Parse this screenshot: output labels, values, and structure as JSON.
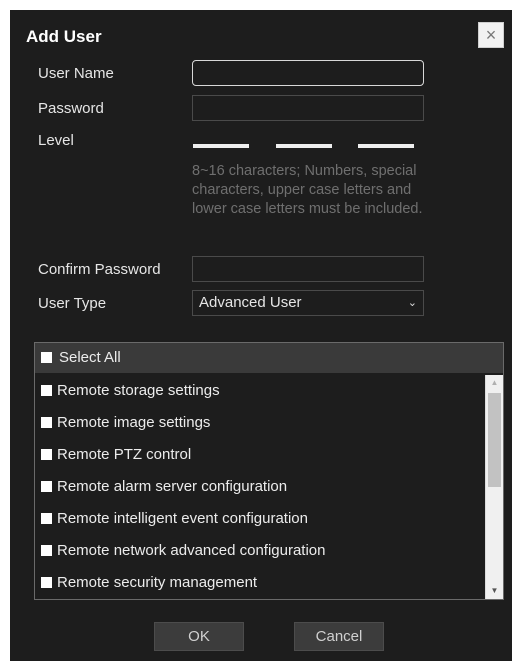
{
  "dialog": {
    "title": "Add User",
    "close_symbol": "×"
  },
  "form": {
    "username_label": "User Name",
    "username_value": "",
    "password_label": "Password",
    "password_value": "",
    "level_label": "Level",
    "password_hint": "8~16 characters; Numbers, special characters, upper case letters and lower case letters must be included.",
    "confirm_label": "Confirm Password",
    "confirm_value": "",
    "user_type_label": "User Type",
    "user_type_value": "Advanced User"
  },
  "permissions": {
    "select_all_label": "Select All",
    "items": [
      "Remote storage settings",
      "Remote image settings",
      "Remote PTZ control",
      "Remote alarm server configuration",
      "Remote intelligent event configuration",
      "Remote network advanced configuration",
      "Remote security management"
    ]
  },
  "buttons": {
    "ok": "OK",
    "cancel": "Cancel"
  },
  "colors": {
    "dialog_bg": "#1d1d1d",
    "header_bg": "#3a3a3a",
    "button_bg": "#3c3c3c",
    "hint_text": "#6f6f6f"
  },
  "icons": {
    "close": "close-icon",
    "dropdown": "chevron-down-icon",
    "scroll_up": "arrow-up-icon",
    "scroll_down": "arrow-down-icon"
  }
}
